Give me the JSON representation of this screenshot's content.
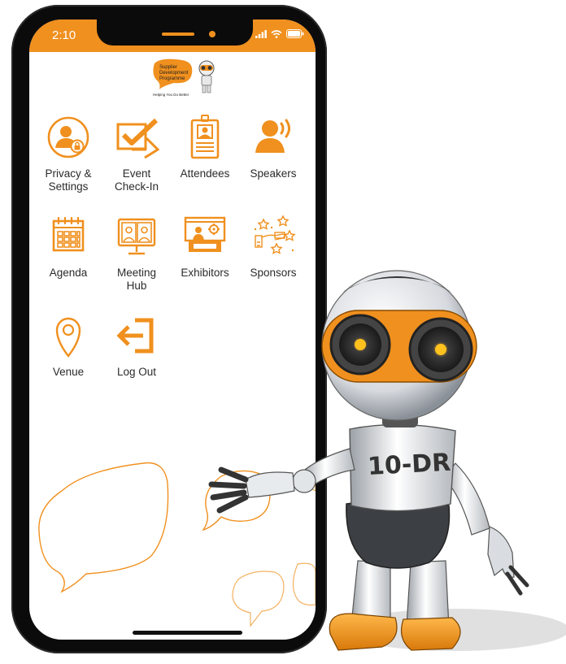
{
  "status_bar": {
    "time": "2:10"
  },
  "logo": {
    "line1": "Supplier",
    "line2": "Development",
    "line3": "Programme",
    "tagline": "Helping You Do Better"
  },
  "menu": {
    "items": [
      {
        "label": "Privacy &\nSettings",
        "icon": "privacy-settings-icon"
      },
      {
        "label": "Event\nCheck-In",
        "icon": "check-in-icon"
      },
      {
        "label": "Attendees",
        "icon": "attendees-icon"
      },
      {
        "label": "Speakers",
        "icon": "speakers-icon"
      },
      {
        "label": "Agenda",
        "icon": "calendar-icon"
      },
      {
        "label": "Meeting\nHub",
        "icon": "meeting-hub-icon"
      },
      {
        "label": "Exhibitors",
        "icon": "exhibitors-icon"
      },
      {
        "label": "Sponsors",
        "icon": "sponsors-icon"
      },
      {
        "label": "Venue",
        "icon": "location-pin-icon"
      },
      {
        "label": "Log Out",
        "icon": "logout-icon"
      }
    ]
  },
  "mascot": {
    "chest_text": "10-DR"
  },
  "colors": {
    "accent": "#f0901e",
    "text": "#2b2b2b",
    "frame": "#0b0b0b"
  }
}
